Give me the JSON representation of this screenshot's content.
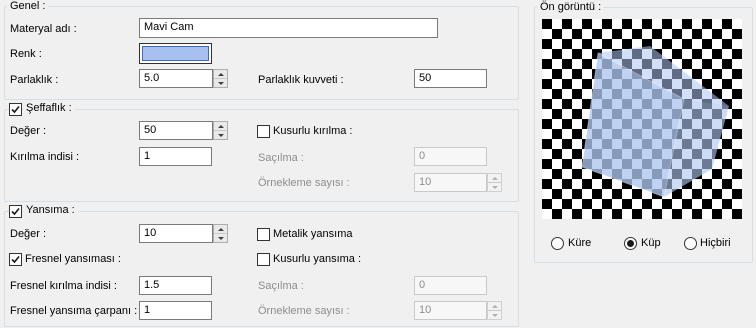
{
  "colors": {
    "glass": "#aec5ee",
    "swatch": "#a7c0ef"
  },
  "general": {
    "title": "Genel :",
    "material_name_label": "Materyal adı :",
    "material_name_value": "Mavi Cam",
    "color_label": "Renk :",
    "brightness_label": "Parlaklık :",
    "brightness_value": "5.0",
    "brightness_strength_label": "Parlaklık kuvveti :",
    "brightness_strength_value": "50"
  },
  "transparency": {
    "title": "Şeffaflık :",
    "enabled": true,
    "value_label": "Değer :",
    "value": "50",
    "imperfect_refraction_label": "Kusurlu kırılma :",
    "imperfect_refraction_checked": false,
    "refraction_index_label": "Kırılma indisi :",
    "refraction_index_value": "1",
    "scatter_label": "Saçılma :",
    "scatter_value": "0",
    "sample_count_label": "Örnekleme sayısı :",
    "sample_count_value": "10"
  },
  "reflection": {
    "title": "Yansıma :",
    "enabled": true,
    "value_label": "Değer :",
    "value": "10",
    "metallic_label": "Metalik yansıma",
    "metallic_checked": false,
    "fresnel_label": "Fresnel yansıması :",
    "fresnel_checked": true,
    "imperfect_reflection_label": "Kusurlu yansıma :",
    "imperfect_reflection_checked": false,
    "fresnel_index_label": "Fresnel kırılma indisi :",
    "fresnel_index_value": "1.5",
    "scatter_label": "Saçılma :",
    "scatter_value": "0",
    "fresnel_multiplier_label": "Fresnel yansıma çarpanı :",
    "fresnel_multiplier_value": "1",
    "sample_count_label": "Örnekleme sayısı :",
    "sample_count_value": "10"
  },
  "preview": {
    "title": "Ön görüntü :",
    "options": [
      "Küre",
      "Küp",
      "Hiçbiri"
    ],
    "selected": "Küp"
  }
}
